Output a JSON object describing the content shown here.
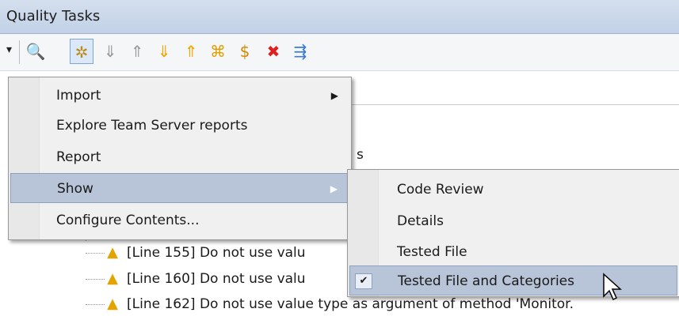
{
  "window": {
    "title": "Quality Tasks"
  },
  "toolbar": {
    "dropdown_glyph": "▾",
    "buttons": [
      {
        "icon": "magnifier-icon",
        "glyph": "🔍",
        "color": "#3c6db0"
      },
      {
        "icon": "bug-icon",
        "glyph": "✲",
        "color": "#c08a1a"
      },
      {
        "icon": "arrow-down-gray-icon",
        "glyph": "⇓",
        "color": "#9a9a9a"
      },
      {
        "icon": "arrow-up-gray-icon",
        "glyph": "⇑",
        "color": "#9a9a9a"
      },
      {
        "icon": "arrow-down-orange-icon",
        "glyph": "⇓",
        "color": "#f0a500"
      },
      {
        "icon": "arrow-up-orange-icon",
        "glyph": "⇑",
        "color": "#f0a500"
      },
      {
        "icon": "expand-all-icon",
        "glyph": "⌘",
        "color": "#e0a000"
      },
      {
        "icon": "sync-icon",
        "glyph": "$",
        "color": "#d08a00"
      },
      {
        "icon": "remove-icon",
        "glyph": "✖",
        "color": "#e02020"
      },
      {
        "icon": "run-icon",
        "glyph": "⇶",
        "color": "#3a7bd5"
      }
    ]
  },
  "tree": {
    "partial_label": "s",
    "rows": [
      {
        "text": "[Line 155] Do not use valu"
      },
      {
        "text": "[Line 160] Do not use valu"
      },
      {
        "text": "[Line 162] Do not use value type as argument of method 'Monitor."
      }
    ]
  },
  "menu": {
    "items": [
      {
        "label": "Import",
        "submenu": true
      },
      {
        "label": "Explore Team Server reports",
        "submenu": false
      },
      {
        "label": "Report",
        "submenu": false
      },
      {
        "label": "Show",
        "submenu": true,
        "active": true
      },
      {
        "label": "Configure Contents...",
        "submenu": false
      }
    ],
    "submenu_arrow": "▶"
  },
  "submenu": {
    "items": [
      {
        "label": "Code Review"
      },
      {
        "label": "Details"
      },
      {
        "label": "Tested File"
      },
      {
        "label": "Tested File and Categories",
        "checked": true,
        "active": true
      }
    ],
    "check_glyph": "✔"
  },
  "colors": {
    "warning": "#e3a400",
    "menu_highlight": "#b8c4d8"
  }
}
